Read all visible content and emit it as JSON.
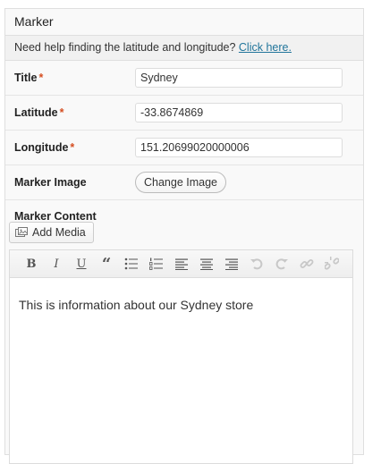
{
  "panel": {
    "title": "Marker"
  },
  "help": {
    "text": "Need help finding the latitude and longitude?",
    "link": "Click here."
  },
  "fields": {
    "title": {
      "label": "Title",
      "required": "*",
      "value": "Sydney"
    },
    "latitude": {
      "label": "Latitude",
      "required": "*",
      "value": "-33.8674869"
    },
    "longitude": {
      "label": "Longitude",
      "required": "*",
      "value": "151.20699020000006"
    },
    "marker_image": {
      "label": "Marker Image",
      "button": "Change Image"
    }
  },
  "content": {
    "label": "Marker Content",
    "add_media": "Add Media",
    "toolbar": {
      "bold": "B",
      "italic": "I",
      "underline": "U",
      "blockquote": "“",
      "icons": [
        "bullet-list-icon",
        "numbered-list-icon",
        "align-left-icon",
        "align-center-icon",
        "align-right-icon",
        "undo-icon",
        "redo-icon",
        "link-icon",
        "unlink-icon"
      ]
    },
    "body_text": "This is information about our Sydney store"
  }
}
